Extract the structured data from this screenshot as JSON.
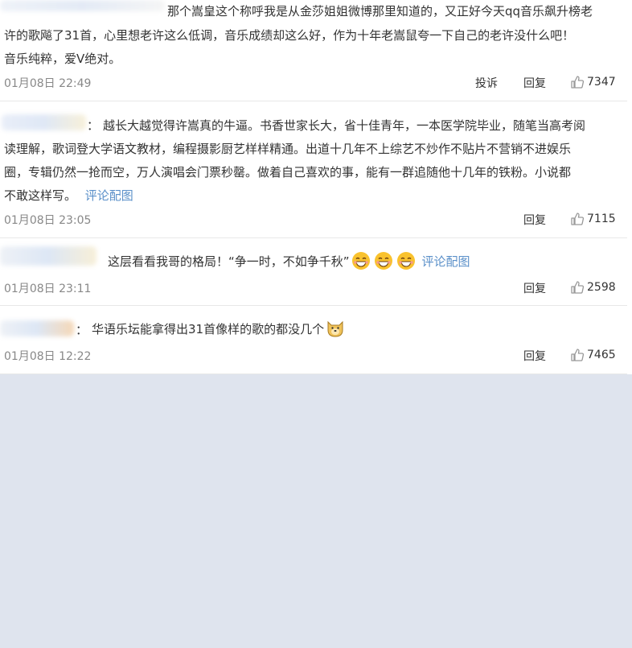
{
  "icons": {
    "like": "thumb-up-icon",
    "grin": "grinning-emoji-icon",
    "doge": "doge-emoji-icon"
  },
  "colors": {
    "link": "#5b90c9",
    "text": "#333333",
    "meta": "#888888",
    "background": "#dfe4ee"
  },
  "comments": [
    {
      "lines": [
        "那个嵩皇这个称呼我是从金莎姐姐微博那里知道的，又正好今天qq音乐飙升榜老",
        "许的歌飚了31首，心里想老许这么低调，音乐成绩却这么好，作为十年老嵩鼠夸一下自己的老许没什么吧！",
        "音乐纯粹，爱V绝对。"
      ],
      "time": "01月08日 22:49",
      "report": "投诉",
      "reply": "回复",
      "likes": "7347"
    },
    {
      "colon": "：",
      "lines": [
        "越长大越觉得许嵩真的牛逼。书香世家长大，省十佳青年，一本医学院毕业，随笔当高考阅",
        "读理解，歌词登大学语文教材，编程摄影厨艺样样精通。出道十几年不上综艺不炒作不贴片不营销不进娱乐",
        "圈，专辑仍然一抢而空，万人演唱会门票秒罄。做着自己喜欢的事，能有一群追随他十几年的铁粉。小说都",
        "不敢这样写。"
      ],
      "pic_link": "评论配图",
      "time": "01月08日 23:05",
      "reply": "回复",
      "likes": "7115"
    },
    {
      "text": "这层看看我哥的格局！“争一时，不如争千秋”",
      "pic_link": "评论配图",
      "time": "01月08日 23:11",
      "reply": "回复",
      "likes": "2598"
    },
    {
      "colon": "：",
      "text": "华语乐坛能拿得出31首像样的歌的都没几个",
      "time": "01月08日 12:22",
      "reply": "回复",
      "likes": "7465"
    }
  ]
}
